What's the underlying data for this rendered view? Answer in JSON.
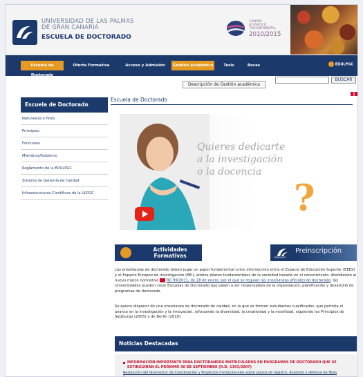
{
  "header": {
    "university_line1": "UNIVERSIDAD DE LAS PALMAS",
    "university_line2": "DE GRAN CANARIA",
    "school": "ESCUELA DE DOCTORADO",
    "cei_text": "CAMPUS ATLÁNTICO TRICONTINENTAL",
    "cei_years": "2010/2015"
  },
  "nav": {
    "items": [
      "Escuela de Doctorado",
      "Oferta Formativa",
      "Acceso y Admisión",
      "Gestión académica",
      "Tesis",
      "Becas"
    ],
    "lang": "EDULPGC"
  },
  "search": {
    "value": "",
    "button": "BUSCAR"
  },
  "gestion_box": "Descripción de Gestión académica",
  "sidebar": {
    "title": "Escuela de Doctorado",
    "items": [
      "Naturaleza y fines",
      "Principios",
      "Funciones",
      "Miembros/Gobierno",
      "Reglamento de la EDULPGC",
      "Sistema de Garantía de Calidad",
      "Infraestructuras Científicas de la ULPGC"
    ]
  },
  "main": {
    "title": "Escuela de Doctorado",
    "hero_line1": "Quieres dedicarte",
    "hero_line2": "a la investigación",
    "hero_line3": "o la docencia",
    "activities_line1": "Actividades",
    "activities_line2": "Formativas",
    "preins_label": "Preinscripción",
    "preins_sub": "EDULPGC",
    "para1_a": "Las enseñanzas de doctorado deben jugar un papel fundamental como intersección entre el Espacio de Educación Superior (EEES) y el Espacio Europeo de Investigación (EEI), ambos pilares fundamentales de la sociedad basada en el conocimiento. Atendiendo al nuevo marco normativo",
    "para1_link": "RD 99/2011, de 28 de enero, por el que se regulan las enseñanzas oficiales de doctorado",
    "para1_b": ", las Universidades pueden crear Escuelas de Doctorado que pasen a ser responsables de la organización, planificación y desarrollo de programas de doctorado.",
    "para2": "Se quiere disponer de una enseñanza de doctorado de calidad, en la que se formen estudiantes cualificados, que permita el avance en la investigación y la innovación, reforzando la diversidad, la creatividad y la movilidad, siguiendo los Principios de Salzburgo (2005) y de Berlín (2010)."
  },
  "news": {
    "title": "Noticias Destacadas",
    "item_title": "INFORMACIÓN IMPORTANTE PARA DOCTORANDOS MATRICULADOS EN PROGRAMAS DE DOCTORADO QUE SE EXTINGUIRÁN EL PRÓXIMO 30 DE SEPTIEMBRE (R.D. 1393/2007)",
    "item_link": "Resolución del Vicerrector de Coordinación y Proyectos Institucionales sobre plazos de registro, depósito y defensa de Tesis Doctorales"
  },
  "colors": {
    "navy": "#1b3a6b",
    "orange": "#e59a23",
    "red": "#c8102e"
  }
}
